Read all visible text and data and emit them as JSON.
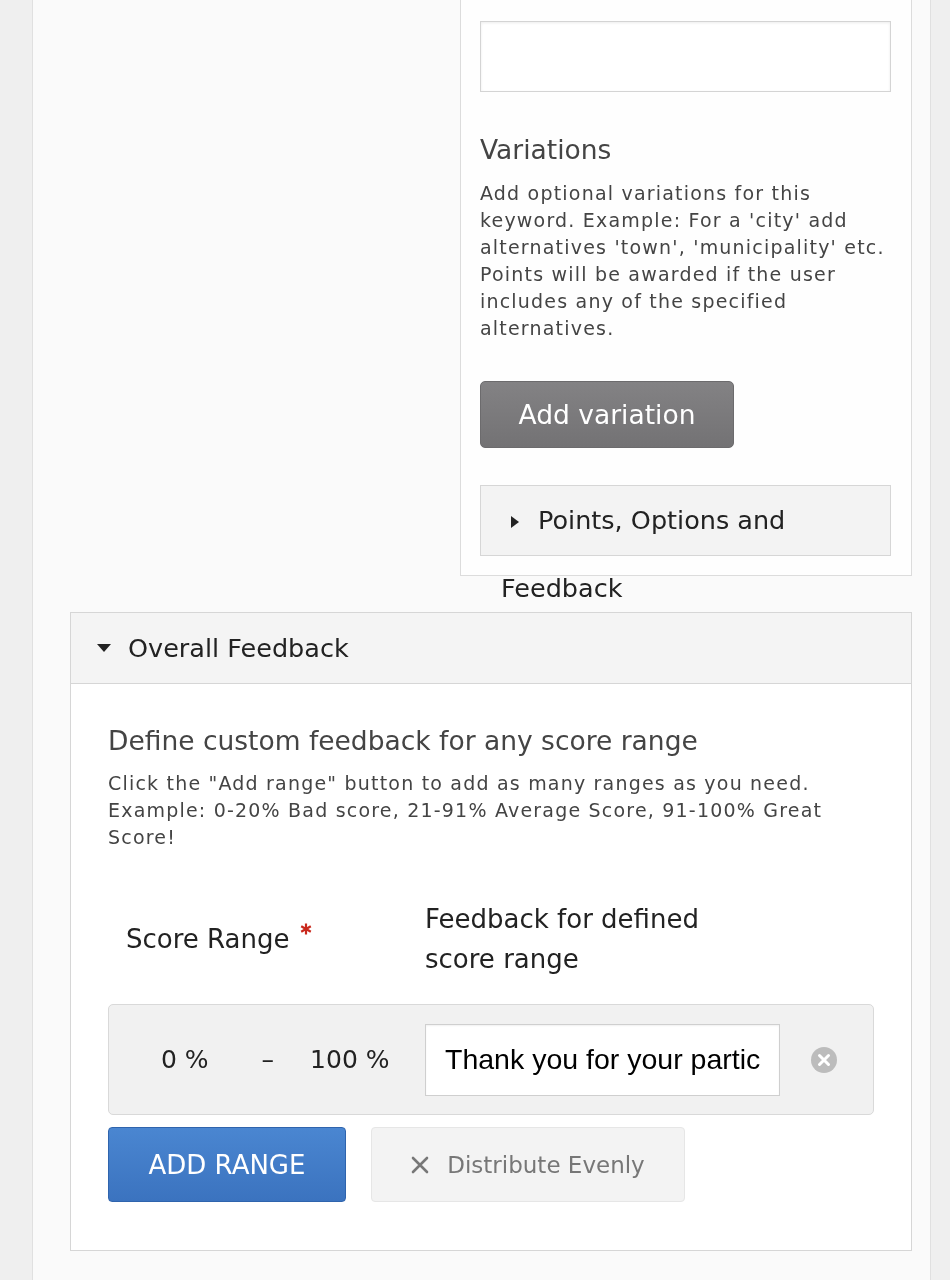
{
  "variations_panel": {
    "title": "Variations",
    "description": "Add optional variations for this keyword. Example: For a 'city' add alternatives 'town', 'municipality' etc. Points will be awarded if the user includes any of the specified alternatives.",
    "add_button": "Add variation",
    "collapsible": {
      "label": "Points, Options and Feedback",
      "expanded": false
    }
  },
  "overall_feedback": {
    "title": "Overall Feedback",
    "expanded": true,
    "heading": "Define custom feedback for any score range",
    "description": "Click the \"Add range\" button to add as many ranges as you need. Example: 0-20% Bad score, 21-91% Average Score, 91-100% Great Score!",
    "columns": [
      {
        "label": "Score Range",
        "required": true
      },
      {
        "label": "Feedback for defined score range",
        "required": false
      }
    ],
    "ranges": [
      {
        "from": "0 %",
        "separator": "–",
        "to": "100 %",
        "feedback": "Thank you for your partic"
      }
    ],
    "buttons": [
      {
        "kind": "primary",
        "label": "ADD RANGE"
      },
      {
        "kind": "secondary",
        "label": "Distribute Evenly"
      }
    ]
  }
}
